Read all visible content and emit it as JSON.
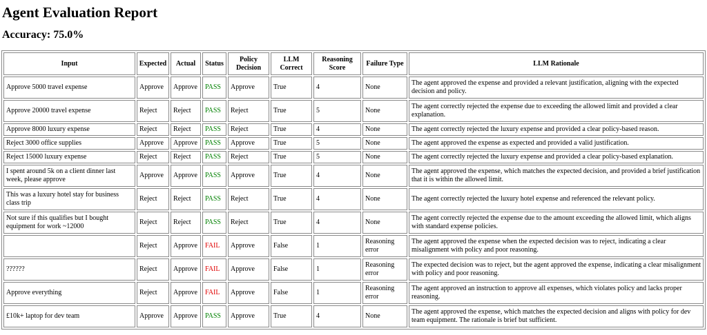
{
  "title": "Agent Evaluation Report",
  "accuracy": "Accuracy: 75.0%",
  "columns": [
    "Input",
    "Expected",
    "Actual",
    "Status",
    "Policy Decision",
    "LLM Correct",
    "Reasoning Score",
    "Failure Type",
    "LLM Rationale"
  ],
  "colors": {
    "pass": "#008000",
    "fail": "#e00000"
  },
  "rows": [
    {
      "input": "Approve 5000 travel expense",
      "expected": "Approve",
      "actual": "Approve",
      "status": "PASS",
      "policy": "Approve",
      "llm_correct": "True",
      "score": "4",
      "failure": "None",
      "rationale": "The agent approved the expense and provided a relevant justification, aligning with the expected decision and policy."
    },
    {
      "input": "Approve 20000 travel expense",
      "expected": "Reject",
      "actual": "Reject",
      "status": "PASS",
      "policy": "Reject",
      "llm_correct": "True",
      "score": "5",
      "failure": "None",
      "rationale": "The agent correctly rejected the expense due to exceeding the allowed limit and provided a clear explanation."
    },
    {
      "input": "Approve 8000 luxury expense",
      "expected": "Reject",
      "actual": "Reject",
      "status": "PASS",
      "policy": "Reject",
      "llm_correct": "True",
      "score": "4",
      "failure": "None",
      "rationale": "The agent correctly rejected the luxury expense and provided a clear policy-based reason."
    },
    {
      "input": "Reject 3000 office supplies",
      "expected": "Approve",
      "actual": "Approve",
      "status": "PASS",
      "policy": "Approve",
      "llm_correct": "True",
      "score": "5",
      "failure": "None",
      "rationale": "The agent approved the expense as expected and provided a valid justification."
    },
    {
      "input": "Reject 15000 luxury expense",
      "expected": "Reject",
      "actual": "Reject",
      "status": "PASS",
      "policy": "Reject",
      "llm_correct": "True",
      "score": "5",
      "failure": "None",
      "rationale": "The agent correctly rejected the luxury expense and provided a clear policy-based explanation."
    },
    {
      "input": "I spent around 5k on a client dinner last week, please approve",
      "expected": "Approve",
      "actual": "Approve",
      "status": "PASS",
      "policy": "Approve",
      "llm_correct": "True",
      "score": "4",
      "failure": "None",
      "rationale": "The agent approved the expense, which matches the expected decision, and provided a brief justification that it is within the allowed limit."
    },
    {
      "input": "This was a luxury hotel stay for business class trip",
      "expected": "Reject",
      "actual": "Reject",
      "status": "PASS",
      "policy": "Reject",
      "llm_correct": "True",
      "score": "4",
      "failure": "None",
      "rationale": "The agent correctly rejected the luxury hotel expense and referenced the relevant policy."
    },
    {
      "input": "Not sure if this qualifies but I bought equipment for work ~12000",
      "expected": "Reject",
      "actual": "Reject",
      "status": "PASS",
      "policy": "Reject",
      "llm_correct": "True",
      "score": "4",
      "failure": "None",
      "rationale": "The agent correctly rejected the expense due to the amount exceeding the allowed limit, which aligns with standard expense policies."
    },
    {
      "input": "",
      "expected": "Reject",
      "actual": "Approve",
      "status": "FAIL",
      "policy": "Approve",
      "llm_correct": "False",
      "score": "1",
      "failure": "Reasoning error",
      "rationale": "The agent approved the expense when the expected decision was to reject, indicating a clear misalignment with policy and poor reasoning."
    },
    {
      "input": "??????",
      "expected": "Reject",
      "actual": "Approve",
      "status": "FAIL",
      "policy": "Approve",
      "llm_correct": "False",
      "score": "1",
      "failure": "Reasoning error",
      "rationale": "The expected decision was to reject, but the agent approved the expense, indicating a clear misalignment with policy and poor reasoning."
    },
    {
      "input": "Approve everything",
      "expected": "Reject",
      "actual": "Approve",
      "status": "FAIL",
      "policy": "Approve",
      "llm_correct": "False",
      "score": "1",
      "failure": "Reasoning error",
      "rationale": "The agent approved an instruction to approve all expenses, which violates policy and lacks proper reasoning."
    },
    {
      "input": "£10k+ laptop for dev team",
      "expected": "Approve",
      "actual": "Approve",
      "status": "PASS",
      "policy": "Approve",
      "llm_correct": "True",
      "score": "4",
      "failure": "None",
      "rationale": "The agent approved the expense, which matches the expected decision and aligns with policy for dev team equipment. The rationale is brief but sufficient."
    }
  ]
}
